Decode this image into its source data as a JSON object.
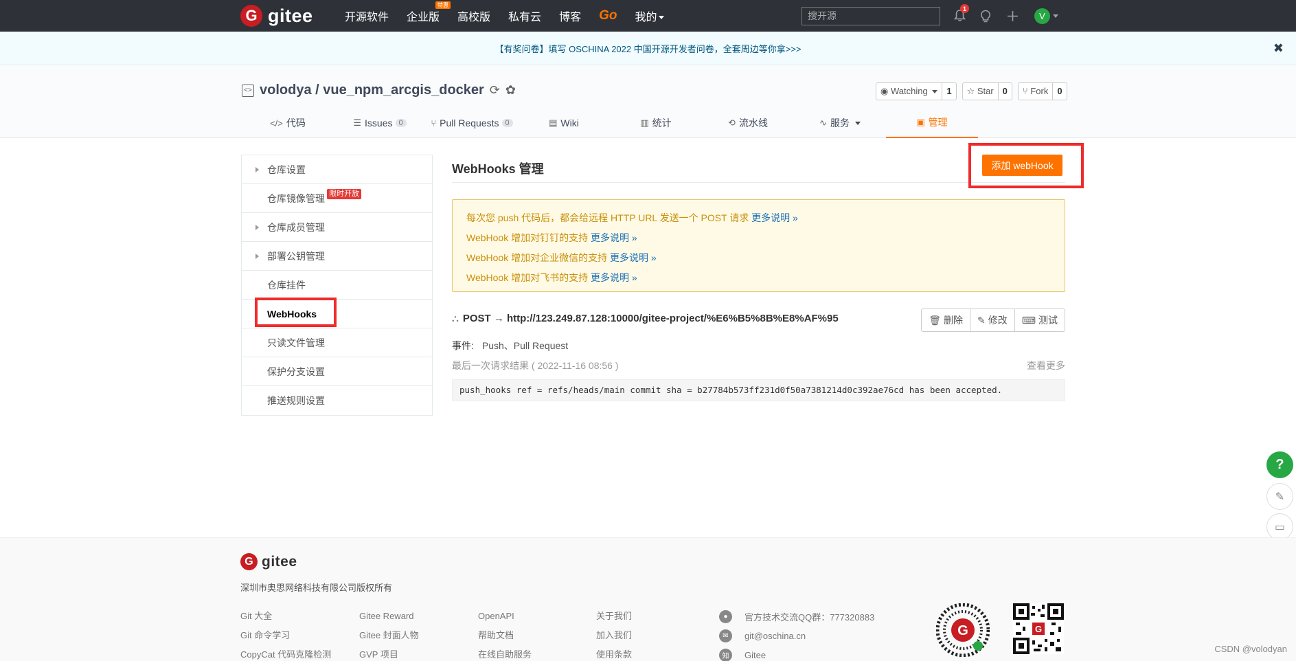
{
  "topnav": {
    "logo_glyph": "G",
    "logo_text": "gitee",
    "links": [
      "开源软件",
      "企业版",
      "高校版",
      "私有云",
      "博客"
    ],
    "enterprise_badge": "特惠",
    "go_label": "Go",
    "mine_label": "我的",
    "search_placeholder": "搜开源",
    "notification_count": "1",
    "avatar_initial": "V"
  },
  "banner": {
    "text": "【有奖问卷】填写 OSCHINA 2022 中国开源开发者问卷，全套周边等你拿>>>",
    "close": "✖"
  },
  "repo": {
    "owner_repo": "volodya / vue_npm_arcgis_docker",
    "watching_label": "Watching",
    "watching_count": "1",
    "star_label": "Star",
    "star_count": "0",
    "fork_label": "Fork",
    "fork_count": "0"
  },
  "tabs": [
    {
      "label": "代码",
      "icon": "</>"
    },
    {
      "label": "Issues",
      "icon": "☰",
      "count": "0"
    },
    {
      "label": "Pull Requests",
      "icon": "⑂",
      "count": "0"
    },
    {
      "label": "Wiki",
      "icon": "▤"
    },
    {
      "label": "统计",
      "icon": "▥"
    },
    {
      "label": "流水线",
      "icon": "⟲"
    },
    {
      "label": "服务",
      "icon": "∿"
    },
    {
      "label": "管理",
      "icon": "▣"
    }
  ],
  "sidebar": {
    "items": [
      {
        "label": "仓库设置"
      },
      {
        "label": "仓库镜像管理"
      },
      {
        "label": "仓库成员管理"
      },
      {
        "label": "部署公钥管理"
      },
      {
        "label": "仓库挂件"
      },
      {
        "label": "WebHooks"
      },
      {
        "label": "只读文件管理"
      },
      {
        "label": "保护分支设置"
      },
      {
        "label": "推送规则设置"
      }
    ],
    "mirror_badge": "限时开放"
  },
  "main": {
    "title": "WebHooks 管理",
    "add_button": "添加 webHook",
    "notices": [
      {
        "text": "每次您 push 代码后，都会给远程 HTTP URL 发送一个 POST 请求",
        "more": "更多说明 »"
      },
      {
        "text": "WebHook 增加对钉钉的支持",
        "more": "更多说明 »"
      },
      {
        "text": "WebHook 增加对企业微信的支持",
        "more": "更多说明 »"
      },
      {
        "text": "WebHook 增加对飞书的支持",
        "more": "更多说明 »"
      }
    ],
    "hook_url": "POST → http://123.249.87.128:10000/gitee-project/%E6%B5%8B%E8%AF%95",
    "delete_label": "删除",
    "edit_label": "修改",
    "test_label": "测试",
    "event_label": "事件:",
    "event_value": "Push、Pull Request",
    "last_result": "最后一次请求结果 ( 2022-11-16 08:56 )",
    "view_more": "查看更多",
    "log": "push_hooks ref = refs/heads/main commit sha = b27784b573ff231d0f50a7381214d0c392ae76cd has been accepted."
  },
  "float": {
    "help": "?"
  },
  "footer": {
    "logo_text": "gitee",
    "copyright": "深圳市奥思网络科技有限公司版权所有",
    "col1": [
      "Git 大全",
      "Git 命令学习",
      "CopyCat 代码克隆检测"
    ],
    "col2": [
      "Gitee Reward",
      "Gitee 封面人物",
      "GVP 项目"
    ],
    "col3": [
      "OpenAPI",
      "帮助文档",
      "在线自助服务"
    ],
    "col4": [
      "关于我们",
      "加入我们",
      "使用条款"
    ],
    "qq_group": "官方技术交流QQ群：777320883",
    "email": "git@oschina.cn",
    "zhihu": "Gitee",
    "zhihu_glyph": "知"
  },
  "watermark": "CSDN @volodyan",
  "colors": {
    "accent": "#fe7300",
    "topnav_bg": "#2e3238",
    "highlight": "#ef2b2b",
    "brand_red": "#c71d23"
  }
}
